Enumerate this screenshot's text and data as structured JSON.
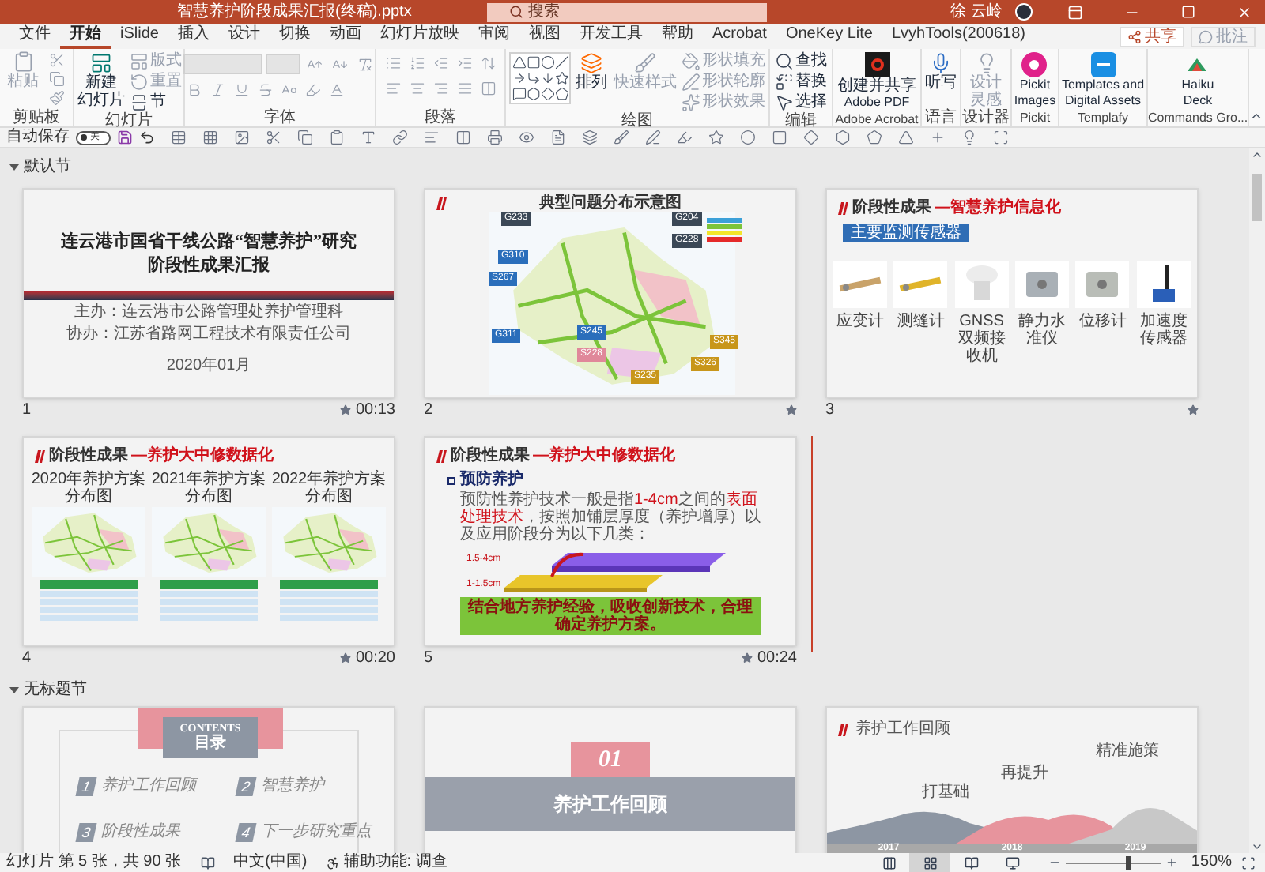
{
  "window": {
    "title": "智慧养护阶段成果汇报(终稿).pptx",
    "search": {
      "placeholder": "搜索"
    },
    "user": "徐 云岭"
  },
  "tabs": [
    {
      "label": "文件",
      "selected": false
    },
    {
      "label": "开始",
      "selected": true
    },
    {
      "label": "iSlide",
      "selected": false
    },
    {
      "label": "插入",
      "selected": false
    },
    {
      "label": "设计",
      "selected": false
    },
    {
      "label": "切换",
      "selected": false
    },
    {
      "label": "动画",
      "selected": false
    },
    {
      "label": "幻灯片放映",
      "selected": false
    },
    {
      "label": "审阅",
      "selected": false
    },
    {
      "label": "视图",
      "selected": false
    },
    {
      "label": "开发工具",
      "selected": false
    },
    {
      "label": "帮助",
      "selected": false
    },
    {
      "label": "Acrobat",
      "selected": false
    },
    {
      "label": "OneKey Lite",
      "selected": false
    },
    {
      "label": "LvyhTools(200618)",
      "selected": false
    }
  ],
  "share_button": "共享",
  "comments_button": {
    "label": "批注",
    "disabled": true
  },
  "ribbon_groups": [
    {
      "kind": "clipboard",
      "label": "剪贴板",
      "buttons": [
        {
          "lines": [
            "粘贴"
          ],
          "disabled": true
        }
      ]
    },
    {
      "kind": "slides",
      "label": "幻灯片",
      "buttons": [
        {
          "lines": [
            "新建",
            "幻灯片"
          ],
          "disabled": false
        },
        {
          "label": "版式",
          "disabled": true
        },
        {
          "label": "重置",
          "disabled": true
        },
        {
          "label": "节",
          "disabled": false
        }
      ]
    },
    {
      "kind": "font",
      "label": "字体"
    },
    {
      "kind": "paragraph",
      "label": "段落"
    },
    {
      "kind": "drawing",
      "label": "绘图",
      "buttons": [
        {
          "lines": [
            "排列"
          ],
          "disabled": false
        },
        {
          "lines": [
            "快速样式"
          ],
          "disabled": true
        },
        {
          "label": "形状填充",
          "disabled": true
        },
        {
          "label": "形状轮廓",
          "disabled": true
        },
        {
          "label": "形状效果",
          "disabled": true
        }
      ]
    },
    {
      "kind": "editing",
      "label": "编辑",
      "buttons": [
        {
          "label": "查找",
          "disabled": false
        },
        {
          "label": "替换",
          "disabled": false
        },
        {
          "label": "选择",
          "disabled": false
        }
      ]
    },
    {
      "kind": "acrobat",
      "label": "Adobe Acrobat",
      "buttons": [
        {
          "lines": [
            "创建并共享",
            "Adobe PDF"
          ],
          "disabled": false
        }
      ]
    },
    {
      "kind": "dictate",
      "label": "语言",
      "buttons": [
        {
          "lines": [
            "听写"
          ],
          "disabled": false
        }
      ]
    },
    {
      "kind": "designer",
      "label": "设计器",
      "buttons": [
        {
          "lines": [
            "设计",
            "灵感"
          ],
          "disabled": true
        }
      ]
    },
    {
      "kind": "pickit",
      "label": "Pickit",
      "buttons": [
        {
          "lines": [
            "Pickit",
            "Images"
          ],
          "disabled": false
        }
      ]
    },
    {
      "kind": "templafy",
      "label": "Templafy",
      "buttons": [
        {
          "lines": [
            "Templates and",
            "Digital Assets"
          ],
          "disabled": false
        }
      ]
    },
    {
      "kind": "haiku",
      "label": "Commands Gro...",
      "buttons": [
        {
          "lines": [
            "Haiku",
            "Deck"
          ],
          "disabled": false
        }
      ]
    }
  ],
  "quick_access": {
    "autosave": {
      "label": "自动保存",
      "on": false,
      "state_label": "关"
    }
  },
  "sections": [
    {
      "title": "默认节",
      "expanded": true,
      "slides": [
        {
          "kind": "title",
          "number": "1",
          "duration": "00:13",
          "transition": true,
          "cursor_after": false,
          "title_lines": [
            "连云港市国省干线公路“智慧养护”研究",
            "阶段性成果汇报"
          ],
          "lines": [
            "主办：连云港市公路管理处养护管理科",
            "协办：江苏省路网工程技术有限责任公司"
          ],
          "date": "2020年01月"
        },
        {
          "kind": "map",
          "number": "2",
          "transition": true,
          "cursor_after": false,
          "title": "典型问题分布示意图",
          "labels": [
            {
              "text": "G233",
              "color": "#3b4856"
            },
            {
              "text": "G204",
              "color": "#3b4856"
            },
            {
              "text": "G228",
              "color": "#3b4856"
            },
            {
              "text": "G310",
              "color": "#2a6ebb"
            },
            {
              "text": "S267",
              "color": "#2a6ebb"
            },
            {
              "text": "G311",
              "color": "#2a6ebb"
            },
            {
              "text": "S245",
              "color": "#2a6ebb"
            },
            {
              "text": "S228",
              "color": "#e0889a"
            },
            {
              "text": "S345",
              "color": "#c8961a"
            },
            {
              "text": "S326",
              "color": "#c8961a"
            },
            {
              "text": "S235",
              "color": "#c8961a"
            }
          ]
        },
        {
          "kind": "sensors",
          "number": "3",
          "transition": true,
          "cursor_after": false,
          "title": "阶段性成果",
          "subtitle": "—智慧养护信息化",
          "tag": "主要监测传感器",
          "items": [
            "应变计",
            "测缝计",
            "GNSS双频接收机",
            "静力水准仪",
            "位移计",
            "加速度传感器"
          ]
        },
        {
          "kind": "maps_compare",
          "number": "4",
          "duration": "00:20",
          "transition": true,
          "cursor_after": false,
          "title": "阶段性成果",
          "subtitle": "—养护大中修数据化",
          "maps": [
            "2020年养护方案分布图",
            "2021年养护方案分布图",
            "2022年养护方案分布图"
          ]
        },
        {
          "kind": "text_diagram",
          "number": "5",
          "duration": "00:24",
          "transition": true,
          "cursor_after": true,
          "title": "阶段性成果",
          "subtitle": "—养护大中修数据化",
          "heading": "预防养护",
          "paragraph": [
            {
              "text": "预防性养护技术一般是指",
              "highlight": false
            },
            {
              "text": "1-4cm",
              "highlight": true
            },
            {
              "text": "之间的",
              "highlight": false
            },
            {
              "text": "表面处理技术",
              "highlight": true
            },
            {
              "text": "，按照加铺层厚度（养护增厚）以及应用阶段分为以下几类：",
              "highlight": false
            }
          ],
          "thickness_labels": [
            "1.5-4cm",
            "1-1.5cm"
          ],
          "banner": "结合地方养护经验，吸收创新技术，合理确定养护方案。"
        }
      ]
    },
    {
      "title": "无标题节",
      "expanded": true,
      "slides": [
        {
          "kind": "contents",
          "banner_en": "CONTENTS",
          "banner": "目录",
          "items": [
            {
              "number": "1",
              "text": "养护工作回顾"
            },
            {
              "number": "2",
              "text": "智慧养护"
            },
            {
              "number": "3",
              "text": "阶段性成果"
            },
            {
              "number": "4",
              "text": "下一步研究重点"
            }
          ]
        },
        {
          "kind": "section",
          "number_text": "01",
          "title": "养护工作回顾"
        },
        {
          "kind": "timeline",
          "title": "养护工作回顾",
          "stages": [
            {
              "label": "打基础",
              "year": "2017"
            },
            {
              "label": "再提升",
              "year": "2018"
            },
            {
              "label": "精准施策",
              "year": "2019"
            }
          ]
        }
      ]
    }
  ],
  "status_bar": {
    "slide_info": "幻灯片 第 5 张，共 90 张",
    "language": "中文(中国)",
    "accessibility": "辅助功能: 调查",
    "views": [
      {
        "kind": "normal",
        "selected": false
      },
      {
        "kind": "sorter",
        "selected": true
      },
      {
        "kind": "reading",
        "selected": false
      },
      {
        "kind": "slideshow",
        "selected": false
      }
    ],
    "zoom": {
      "level": 0.62,
      "reading": "150%"
    }
  }
}
